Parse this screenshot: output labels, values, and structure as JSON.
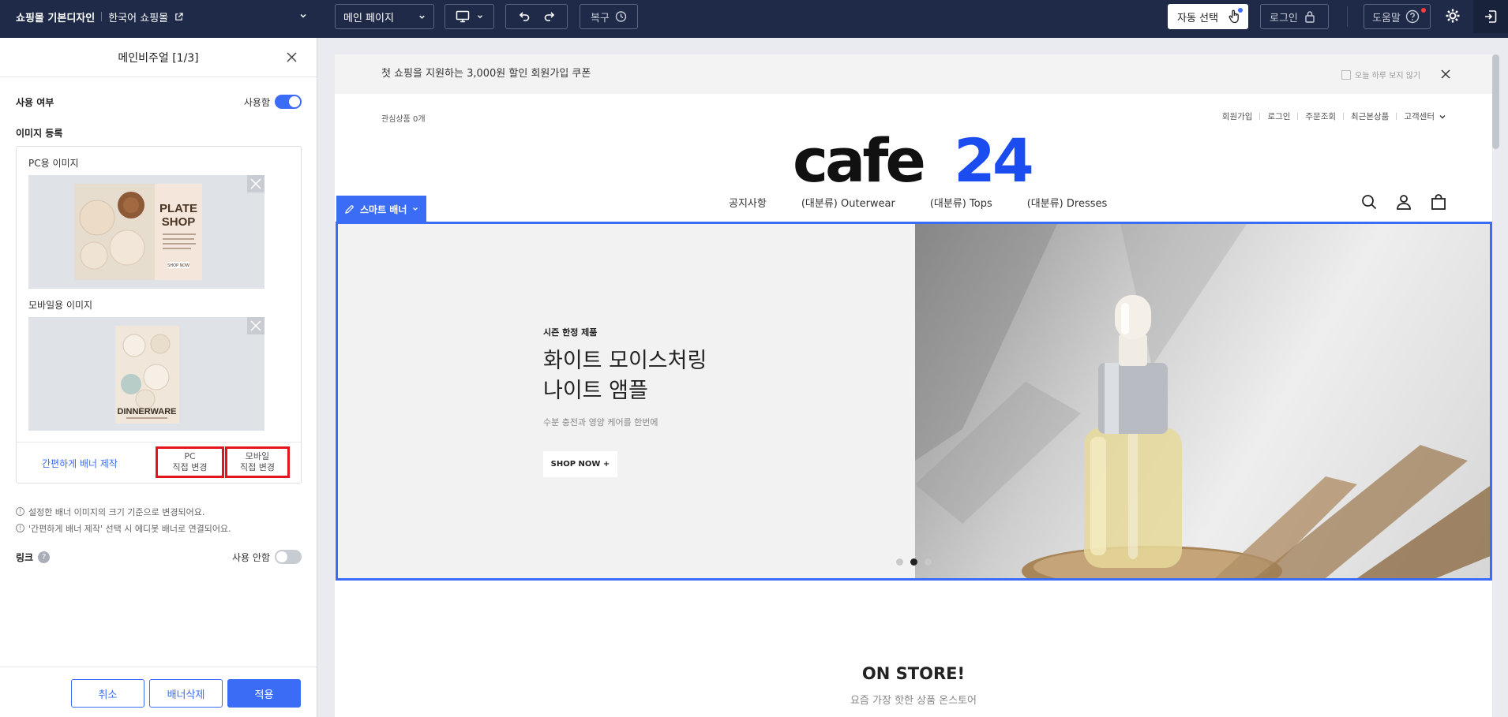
{
  "topbar": {
    "site_name": "쇼핑몰 기본디자인",
    "shop_name": "한국어 쇼핑몰",
    "page_select": "메인 페이지",
    "restore": "복구",
    "auto_select": "자동 선택",
    "login": "로그인",
    "help": "도움말"
  },
  "panel": {
    "title": "메인비주얼 [1/3]",
    "use_label": "사용 여부",
    "use_state": "사용함",
    "image_reg_label": "이미지 등록",
    "pc_image_label": "PC용 이미지",
    "mobile_image_label": "모바일용 이미지",
    "pc_thumb_text": {
      "line1": "PLATE",
      "line2": "SHOP",
      "button": "SHOP NOW"
    },
    "mobile_thumb_text": "DINNERWARE",
    "easy_banner": "간편하게 배너 제작",
    "pc_edit": {
      "line1": "PC",
      "line2": "직접 변경"
    },
    "mobile_edit": {
      "line1": "모바일",
      "line2": "직접 변경"
    },
    "notes": [
      "설정한 배너 이미지의 크기 기준으로 변경되어요.",
      "'간편하게 배너 제작' 선택 시 에디봇 배너로 연결되어요."
    ],
    "link_label": "링크",
    "link_state": "사용 안함",
    "footer": {
      "cancel": "취소",
      "delete": "배너삭제",
      "apply": "적용"
    }
  },
  "preview": {
    "promo": "첫 쇼핑을 지원하는 3,000원 할인 회원가입 쿠폰",
    "promo_hide": "오늘 하루 보지 않기",
    "wishlist": "관심상품 0개",
    "util_links": [
      "회원가입",
      "로그인",
      "주문조회",
      "최근본상품",
      "고객센터"
    ],
    "logo": {
      "part1": "cafe",
      "part2": "24"
    },
    "nav": [
      "공지사항",
      "(대분류) Outerwear",
      "(대분류) Tops",
      "(대분류) Dresses"
    ],
    "smart_banner": "스마트 배너",
    "hero": {
      "kicker": "시즌 한정 제품",
      "title_line1": "화이트 모이스처링",
      "title_line2": "나이트 앰플",
      "desc": "수분 충전과 영양 케어를 한번에",
      "button": "SHOP NOW +"
    },
    "onstore_title": "ON STORE!",
    "onstore_sub": "요즘 가장 핫한 상품 온스토어"
  },
  "colors": {
    "topbar_bg": "#1e2a48",
    "accent": "#3b6cf6",
    "highlight_red": "#e3141b"
  }
}
